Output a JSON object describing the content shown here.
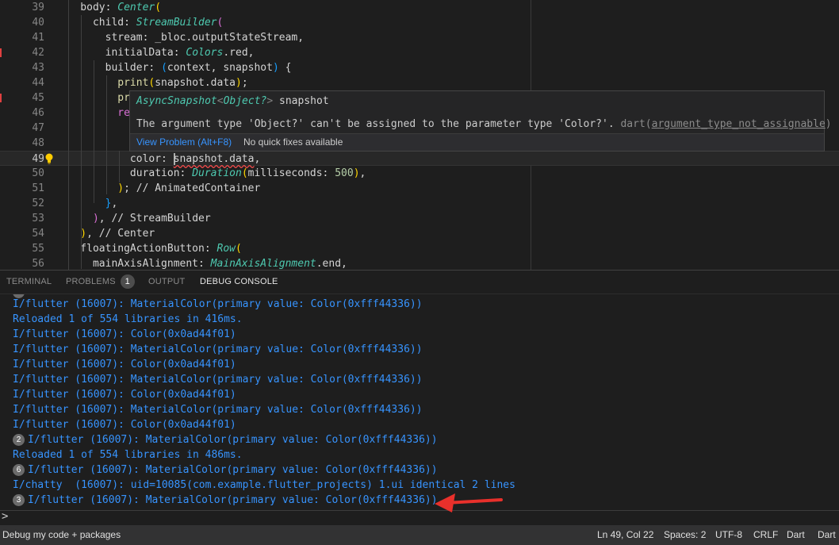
{
  "editor": {
    "lines": [
      {
        "n": "39",
        "segs": [
          [
            "punc",
            "    body: "
          ],
          [
            "cls",
            "Center"
          ],
          [
            "gold",
            "("
          ]
        ]
      },
      {
        "n": "40",
        "segs": [
          [
            "punc",
            "      child: "
          ],
          [
            "cls",
            "StreamBuilder"
          ],
          [
            "pink",
            "("
          ]
        ]
      },
      {
        "n": "41",
        "segs": [
          [
            "punc",
            "        stream: _bloc.outputStateStream,"
          ]
        ]
      },
      {
        "n": "42",
        "segs": [
          [
            "punc",
            "        initialData: "
          ],
          [
            "cls",
            "Colors"
          ],
          [
            "punc",
            ".red,"
          ]
        ]
      },
      {
        "n": "43",
        "segs": [
          [
            "punc",
            "        builder: "
          ],
          [
            "blueb",
            "("
          ],
          [
            "punc",
            "context, snapshot"
          ],
          [
            "blueb",
            ")"
          ],
          [
            "punc",
            " {"
          ]
        ]
      },
      {
        "n": "44",
        "segs": [
          [
            "fn",
            "          print"
          ],
          [
            "gold",
            "("
          ],
          [
            "punc",
            "snapshot.data"
          ],
          [
            "gold",
            ")"
          ],
          [
            "punc",
            ";"
          ]
        ]
      },
      {
        "n": "45",
        "segs": [
          [
            "fn",
            "          pr"
          ]
        ]
      },
      {
        "n": "46",
        "segs": [
          [
            "pink",
            "          re"
          ]
        ]
      },
      {
        "n": "47",
        "segs": []
      },
      {
        "n": "48",
        "segs": []
      },
      {
        "n": "49",
        "segs": [
          [
            "punc",
            "            color: "
          ],
          [
            "cursor",
            ""
          ],
          [
            "squig",
            "snapshot.data"
          ],
          [
            "punc",
            ","
          ]
        ]
      },
      {
        "n": "50",
        "segs": [
          [
            "punc",
            "            duration: "
          ],
          [
            "cls",
            "Duration"
          ],
          [
            "gold",
            "("
          ],
          [
            "punc",
            "milliseconds: "
          ],
          [
            "num",
            "500"
          ],
          [
            "gold",
            ")"
          ],
          [
            "punc",
            ","
          ]
        ]
      },
      {
        "n": "51",
        "segs": [
          [
            "gold",
            "          )"
          ],
          [
            "punc",
            "; // AnimatedContainer"
          ]
        ]
      },
      {
        "n": "52",
        "segs": [
          [
            "blueb",
            "        }"
          ],
          [
            "punc",
            ","
          ]
        ]
      },
      {
        "n": "53",
        "segs": [
          [
            "pink",
            "      )"
          ],
          [
            "punc",
            ", // StreamBuilder"
          ]
        ]
      },
      {
        "n": "54",
        "segs": [
          [
            "gold",
            "    )"
          ],
          [
            "punc",
            ", // Center"
          ]
        ]
      },
      {
        "n": "55",
        "segs": [
          [
            "punc",
            "    floatingActionButton: "
          ],
          [
            "cls",
            "Row"
          ],
          [
            "gold",
            "("
          ]
        ]
      },
      {
        "n": "56",
        "segs": [
          [
            "punc",
            "      mainAxisAlignment: "
          ],
          [
            "cls",
            "MainAxisAlignment"
          ],
          [
            "punc",
            ".end,"
          ]
        ]
      }
    ]
  },
  "hover": {
    "type_name": "AsyncSnapshot",
    "type_open": "<",
    "type_arg": "Object?",
    "type_close": ">",
    "var_name": " snapshot",
    "message": "The argument type 'Object?' can't be assigned to the parameter type 'Color?'. ",
    "source": "dart",
    "code_open": "(",
    "code": "argument_type_not_assignable",
    "code_close": ")",
    "view_problem": "View Problem (Alt+F8)",
    "no_fixes": "No quick fixes available"
  },
  "panel": {
    "tabs": {
      "terminal": "TERMINAL",
      "problems": "PROBLEMS",
      "problems_count": "1",
      "output": "OUTPUT",
      "debug_console": "DEBUG CONSOLE"
    }
  },
  "console": {
    "lines": [
      {
        "c": "",
        "t": "I/flutter (16007): MaterialColor(primary value: Color(0xfff44336))"
      },
      {
        "c": "",
        "t": "Reloaded 1 of 554 libraries in 416ms."
      },
      {
        "c": "",
        "t": "I/flutter (16007): Color(0x0ad44f01)"
      },
      {
        "c": "",
        "t": "I/flutter (16007): MaterialColor(primary value: Color(0xfff44336))"
      },
      {
        "c": "",
        "t": "I/flutter (16007): Color(0x0ad44f01)"
      },
      {
        "c": "",
        "t": "I/flutter (16007): MaterialColor(primary value: Color(0xfff44336))"
      },
      {
        "c": "",
        "t": "I/flutter (16007): Color(0x0ad44f01)"
      },
      {
        "c": "",
        "t": "I/flutter (16007): MaterialColor(primary value: Color(0xfff44336))"
      },
      {
        "c": "",
        "t": "I/flutter (16007): Color(0x0ad44f01)"
      },
      {
        "c": "2",
        "t": "I/flutter (16007): MaterialColor(primary value: Color(0xfff44336))"
      },
      {
        "c": "",
        "t": "Reloaded 1 of 554 libraries in 486ms."
      },
      {
        "c": "6",
        "t": "I/flutter (16007): MaterialColor(primary value: Color(0xfff44336))"
      },
      {
        "c": "",
        "t": "I/chatty  (16007): uid=10085(com.example.flutter_projects) 1.ui identical 2 lines"
      },
      {
        "c": "3",
        "t": "I/flutter (16007): MaterialColor(primary value: Color(0xfff44336))"
      }
    ],
    "prompt": ">"
  },
  "statusbar": {
    "debug_mode": "Debug my code + packages",
    "position": "Ln 49, Col 22",
    "spaces": "Spaces: 2",
    "encoding": "UTF-8",
    "eol": "CRLF",
    "language": "Dart",
    "sdk": "Dart"
  },
  "colors": {
    "console_text": "#3794ff",
    "arrow": "#e8302b",
    "error_squiggle": "#f14c4c"
  }
}
